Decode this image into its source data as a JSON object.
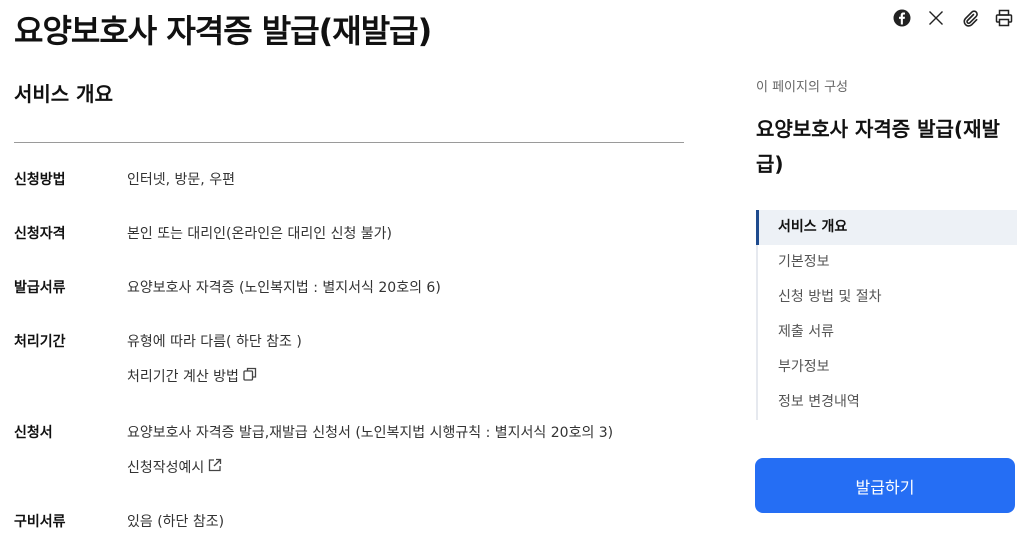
{
  "page": {
    "title": "요양보호사 자격증 발급(재발급)"
  },
  "share": {
    "icons": [
      "facebook-icon",
      "x-icon",
      "paperclip-icon",
      "printer-icon"
    ]
  },
  "overview": {
    "title": "서비스 개요",
    "rows": [
      {
        "label": "신청방법",
        "value": "인터넷, 방문, 우편"
      },
      {
        "label": "신청자격",
        "value": "본인 또는 대리인(온라인은 대리인 신청 불가)"
      },
      {
        "label": "발급서류",
        "value": "요양보호사 자격증 (노인복지법 : 별지서식 20호의 6)"
      },
      {
        "label": "처리기간",
        "value": "유형에 따라 다름( 하단 참조 )",
        "link": "처리기간 계산 방법"
      },
      {
        "label": "신청서",
        "value": "요양보호사 자격증 발급,재발급 신청서 (노인복지법 시행규칙 : 별지서식 20호의 3)",
        "link": "신청작성예시"
      },
      {
        "label": "구비서류",
        "value": "있음 (하단 참조)"
      }
    ]
  },
  "toc": {
    "heading": "이 페이지의 구성",
    "title": "요양보호사 자격증 발급(재발급)",
    "items": [
      {
        "label": "서비스 개요"
      },
      {
        "label": "기본정보"
      },
      {
        "label": "신청 방법 및 절차"
      },
      {
        "label": "제출 서류"
      },
      {
        "label": "부가정보"
      },
      {
        "label": "정보 변경내역"
      }
    ],
    "active_index": 0
  },
  "actions": {
    "apply_label": "발급하기"
  },
  "colors": {
    "accent": "#256ef4",
    "active_marker": "#1e4b8e"
  }
}
